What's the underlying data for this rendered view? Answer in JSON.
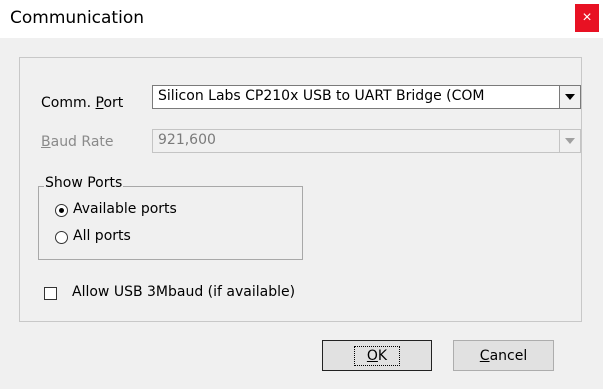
{
  "window": {
    "title": "Communication",
    "close_glyph": "×"
  },
  "comm_port": {
    "label_prefix": "Comm. ",
    "label_underlined": "P",
    "label_suffix": "ort",
    "value": "Silicon Labs CP210x USB to UART Bridge (COM"
  },
  "baud_rate": {
    "label_underlined": "B",
    "label_suffix": "aud Rate",
    "value": "921,600"
  },
  "show_ports": {
    "legend": "Show Ports",
    "options": [
      {
        "label": "Available ports",
        "selected": true
      },
      {
        "label": "All ports",
        "selected": false
      }
    ]
  },
  "usb_option": {
    "label": "Allow USB 3Mbaud (if available)",
    "checked": false
  },
  "buttons": {
    "ok_underlined": "O",
    "ok_suffix": "K",
    "cancel_underlined": "C",
    "cancel_suffix": "ancel"
  },
  "colors": {
    "close_button": "#e81123",
    "dialog_background": "#f0f0f0"
  },
  "icons": {
    "close": "close-icon",
    "dropdown": "chevron-down-icon"
  }
}
